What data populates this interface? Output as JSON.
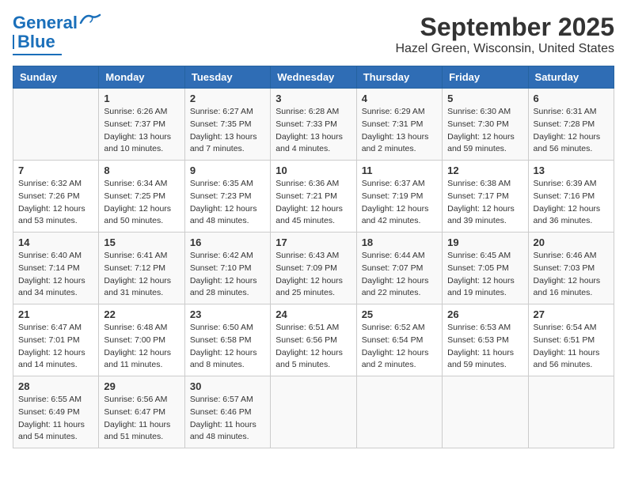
{
  "header": {
    "logo_line1": "General",
    "logo_line2": "Blue",
    "title": "September 2025",
    "subtitle": "Hazel Green, Wisconsin, United States"
  },
  "days_of_week": [
    "Sunday",
    "Monday",
    "Tuesday",
    "Wednesday",
    "Thursday",
    "Friday",
    "Saturday"
  ],
  "weeks": [
    [
      {
        "day": "",
        "info": ""
      },
      {
        "day": "1",
        "info": "Sunrise: 6:26 AM\nSunset: 7:37 PM\nDaylight: 13 hours\nand 10 minutes."
      },
      {
        "day": "2",
        "info": "Sunrise: 6:27 AM\nSunset: 7:35 PM\nDaylight: 13 hours\nand 7 minutes."
      },
      {
        "day": "3",
        "info": "Sunrise: 6:28 AM\nSunset: 7:33 PM\nDaylight: 13 hours\nand 4 minutes."
      },
      {
        "day": "4",
        "info": "Sunrise: 6:29 AM\nSunset: 7:31 PM\nDaylight: 13 hours\nand 2 minutes."
      },
      {
        "day": "5",
        "info": "Sunrise: 6:30 AM\nSunset: 7:30 PM\nDaylight: 12 hours\nand 59 minutes."
      },
      {
        "day": "6",
        "info": "Sunrise: 6:31 AM\nSunset: 7:28 PM\nDaylight: 12 hours\nand 56 minutes."
      }
    ],
    [
      {
        "day": "7",
        "info": "Sunrise: 6:32 AM\nSunset: 7:26 PM\nDaylight: 12 hours\nand 53 minutes."
      },
      {
        "day": "8",
        "info": "Sunrise: 6:34 AM\nSunset: 7:25 PM\nDaylight: 12 hours\nand 50 minutes."
      },
      {
        "day": "9",
        "info": "Sunrise: 6:35 AM\nSunset: 7:23 PM\nDaylight: 12 hours\nand 48 minutes."
      },
      {
        "day": "10",
        "info": "Sunrise: 6:36 AM\nSunset: 7:21 PM\nDaylight: 12 hours\nand 45 minutes."
      },
      {
        "day": "11",
        "info": "Sunrise: 6:37 AM\nSunset: 7:19 PM\nDaylight: 12 hours\nand 42 minutes."
      },
      {
        "day": "12",
        "info": "Sunrise: 6:38 AM\nSunset: 7:17 PM\nDaylight: 12 hours\nand 39 minutes."
      },
      {
        "day": "13",
        "info": "Sunrise: 6:39 AM\nSunset: 7:16 PM\nDaylight: 12 hours\nand 36 minutes."
      }
    ],
    [
      {
        "day": "14",
        "info": "Sunrise: 6:40 AM\nSunset: 7:14 PM\nDaylight: 12 hours\nand 34 minutes."
      },
      {
        "day": "15",
        "info": "Sunrise: 6:41 AM\nSunset: 7:12 PM\nDaylight: 12 hours\nand 31 minutes."
      },
      {
        "day": "16",
        "info": "Sunrise: 6:42 AM\nSunset: 7:10 PM\nDaylight: 12 hours\nand 28 minutes."
      },
      {
        "day": "17",
        "info": "Sunrise: 6:43 AM\nSunset: 7:09 PM\nDaylight: 12 hours\nand 25 minutes."
      },
      {
        "day": "18",
        "info": "Sunrise: 6:44 AM\nSunset: 7:07 PM\nDaylight: 12 hours\nand 22 minutes."
      },
      {
        "day": "19",
        "info": "Sunrise: 6:45 AM\nSunset: 7:05 PM\nDaylight: 12 hours\nand 19 minutes."
      },
      {
        "day": "20",
        "info": "Sunrise: 6:46 AM\nSunset: 7:03 PM\nDaylight: 12 hours\nand 16 minutes."
      }
    ],
    [
      {
        "day": "21",
        "info": "Sunrise: 6:47 AM\nSunset: 7:01 PM\nDaylight: 12 hours\nand 14 minutes."
      },
      {
        "day": "22",
        "info": "Sunrise: 6:48 AM\nSunset: 7:00 PM\nDaylight: 12 hours\nand 11 minutes."
      },
      {
        "day": "23",
        "info": "Sunrise: 6:50 AM\nSunset: 6:58 PM\nDaylight: 12 hours\nand 8 minutes."
      },
      {
        "day": "24",
        "info": "Sunrise: 6:51 AM\nSunset: 6:56 PM\nDaylight: 12 hours\nand 5 minutes."
      },
      {
        "day": "25",
        "info": "Sunrise: 6:52 AM\nSunset: 6:54 PM\nDaylight: 12 hours\nand 2 minutes."
      },
      {
        "day": "26",
        "info": "Sunrise: 6:53 AM\nSunset: 6:53 PM\nDaylight: 11 hours\nand 59 minutes."
      },
      {
        "day": "27",
        "info": "Sunrise: 6:54 AM\nSunset: 6:51 PM\nDaylight: 11 hours\nand 56 minutes."
      }
    ],
    [
      {
        "day": "28",
        "info": "Sunrise: 6:55 AM\nSunset: 6:49 PM\nDaylight: 11 hours\nand 54 minutes."
      },
      {
        "day": "29",
        "info": "Sunrise: 6:56 AM\nSunset: 6:47 PM\nDaylight: 11 hours\nand 51 minutes."
      },
      {
        "day": "30",
        "info": "Sunrise: 6:57 AM\nSunset: 6:46 PM\nDaylight: 11 hours\nand 48 minutes."
      },
      {
        "day": "",
        "info": ""
      },
      {
        "day": "",
        "info": ""
      },
      {
        "day": "",
        "info": ""
      },
      {
        "day": "",
        "info": ""
      }
    ]
  ]
}
